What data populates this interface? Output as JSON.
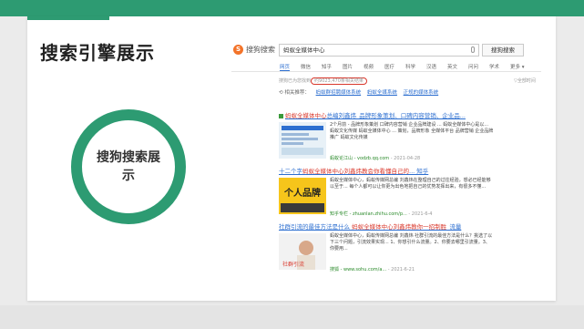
{
  "slide": {
    "title": "搜索引擎展示",
    "circle_text": "搜狗搜索展示"
  },
  "browser": {
    "logo_icon": "S",
    "logo_text": "搜狗搜索",
    "search_value": "蚂蚁全媒体中心",
    "search_button": "搜狗搜索",
    "tabs": [
      "网页",
      "微信",
      "知乎",
      "图片",
      "视频",
      "医疗",
      "科学",
      "汉语",
      "英文",
      "问问",
      "学术",
      "更多 ▾"
    ],
    "stats_prefix": "搜狗已为您找到",
    "stats_count": "约9023,470条相关结果",
    "tools": "▽全部时间",
    "related_label": "⟲ 相关推荐：",
    "related_links": [
      "蚂蚁群招聘媒体系统",
      "蚂蚁全媒系统",
      "正规的媒体系统"
    ],
    "results": [
      {
        "title_hl": "蚂蚁全媒体中心",
        "title_rest": "总编刘鑫炜_品牌形象策划、口碑内容营销、企业品...",
        "snippet": "2个月前 - 品牌形象策划 口碑内容营销 企业品牌建设 ... 蚂蚁全媒体中心是以... 蚂蚁文化传媒 蚂蚁全媒体中心 ... 策划，品牌形象 全媒体平台 品牌营销 企业品牌推广 蚂蚁文化传媒",
        "url": "蚂蚁论江山 - vodzb.qq.com",
        "date": " - 2021-04-28"
      },
      {
        "title_hl": "十二个字",
        "title_mid": "蚂蚁全媒体中心刘鑫炜教会你看懂自己的",
        "title_rest": "... 知乎",
        "snippet": "蚂蚁全媒体中心，蚂蚁传媒网总编 刘鑫炜在整理自己的过往经验，想必已经能够以至于... 每个人都可以让你更为出色地把自己的优势发挥出来，有很多不懂...",
        "url": "知乎专栏 - zhuanlan.zhihu.com/p...",
        "date": " - 2021-6-4"
      },
      {
        "title_hl": "社群引流的最佳方法是什么",
        "title_mid": " 蚂蚁全媒体中心刘鑫炜教你一招制胜",
        "title_rest": "_流量",
        "snippet": "蚂蚁全媒体中心，蚂蚁传媒网总编 刘鑫炜 社群引流的最佳方法是什么？挑选了以下三个问题，引流效果实现... 1、你想引什么流量。2、你要去哪里引流量。3、你要用...",
        "url": "搜狐 - www.sohu.com/a...",
        "date": " - 2021-6-21"
      }
    ],
    "thumb_2_text": "个人品牌",
    "thumb_3_text": "社群引流"
  },
  "colors": {
    "accent": "#2d9b72",
    "link": "#2d6fd0",
    "highlight": "#d9372b"
  }
}
